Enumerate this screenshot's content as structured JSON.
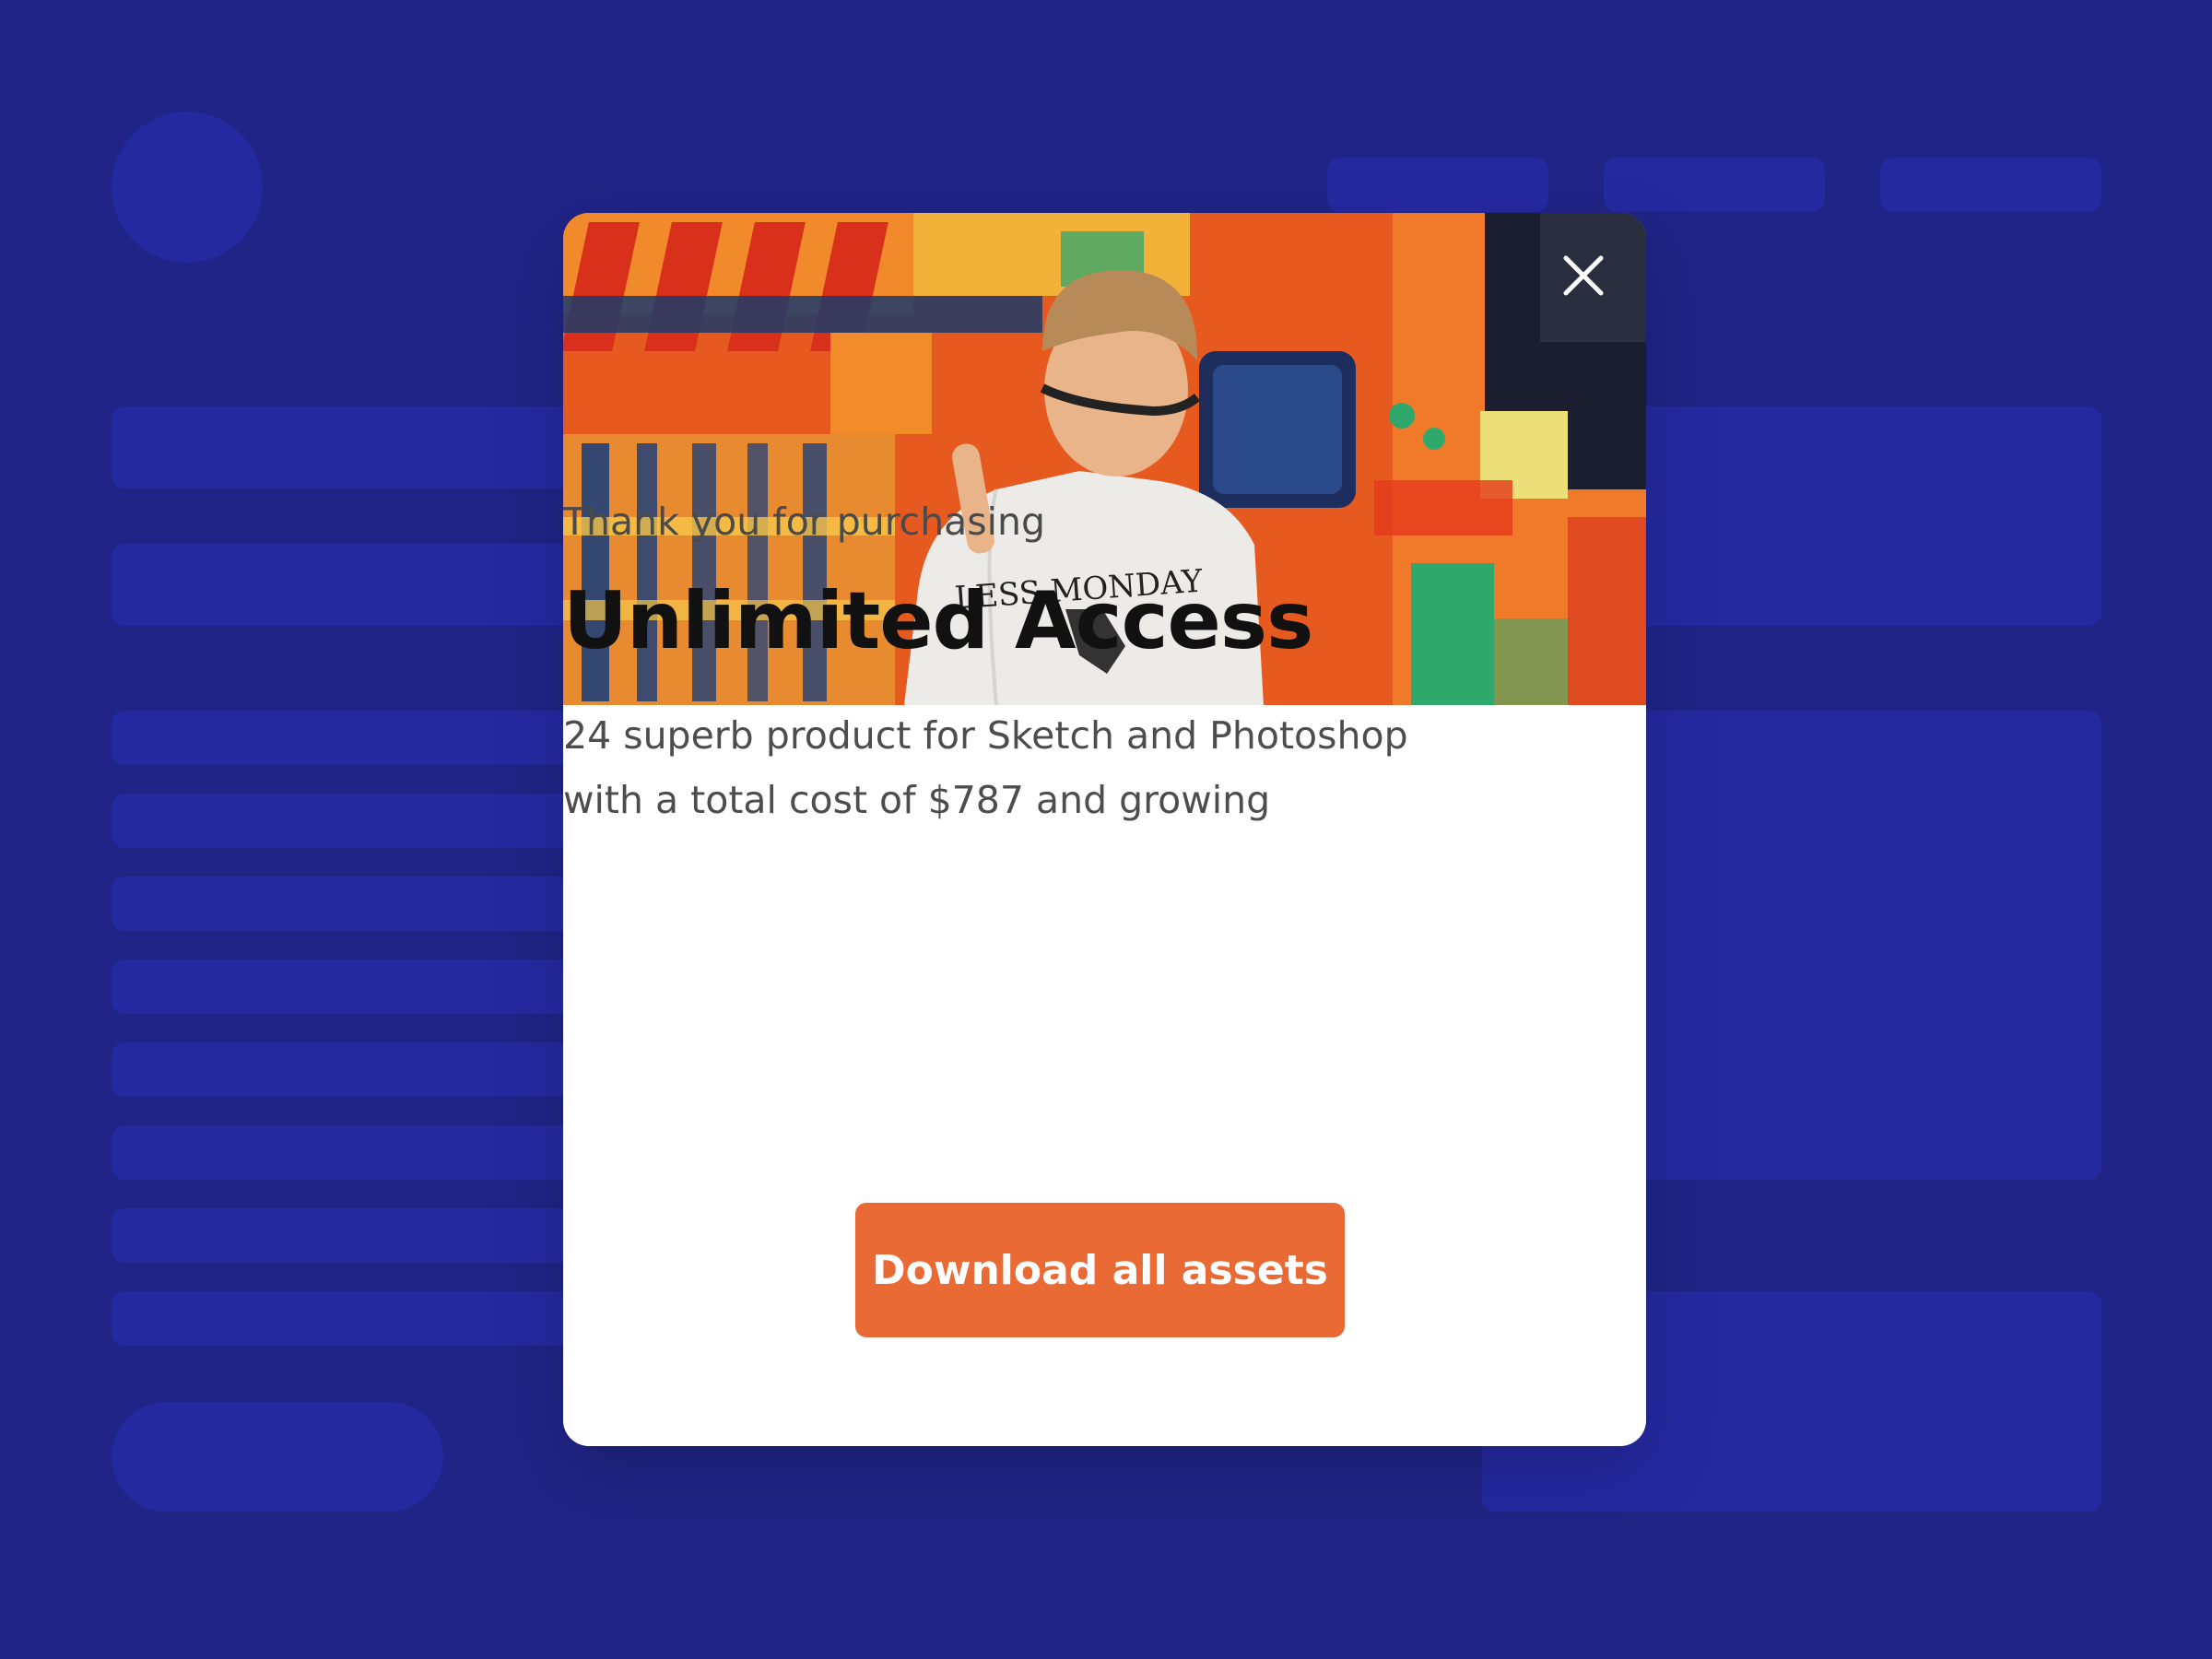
{
  "modal": {
    "subtitle": "Thank you for purchasing",
    "title": "Unlimited Access",
    "description_line1": "24 superb product for Sketch and Photoshop",
    "description_line2": "with a total cost of $787 and growing",
    "cta_label": "Download all assets",
    "close_icon": "close-icon",
    "hero_image": "photo of a person in a white t-shirt facing a colorful painted wall",
    "hero_shirt_text": "LESS MONDAY"
  },
  "colors": {
    "background": "#1f2486",
    "placeholder": "#2529a0",
    "modal": "#ffffff",
    "cta": "#e96a34",
    "title": "#111111",
    "body_text": "#4d4d4d"
  }
}
